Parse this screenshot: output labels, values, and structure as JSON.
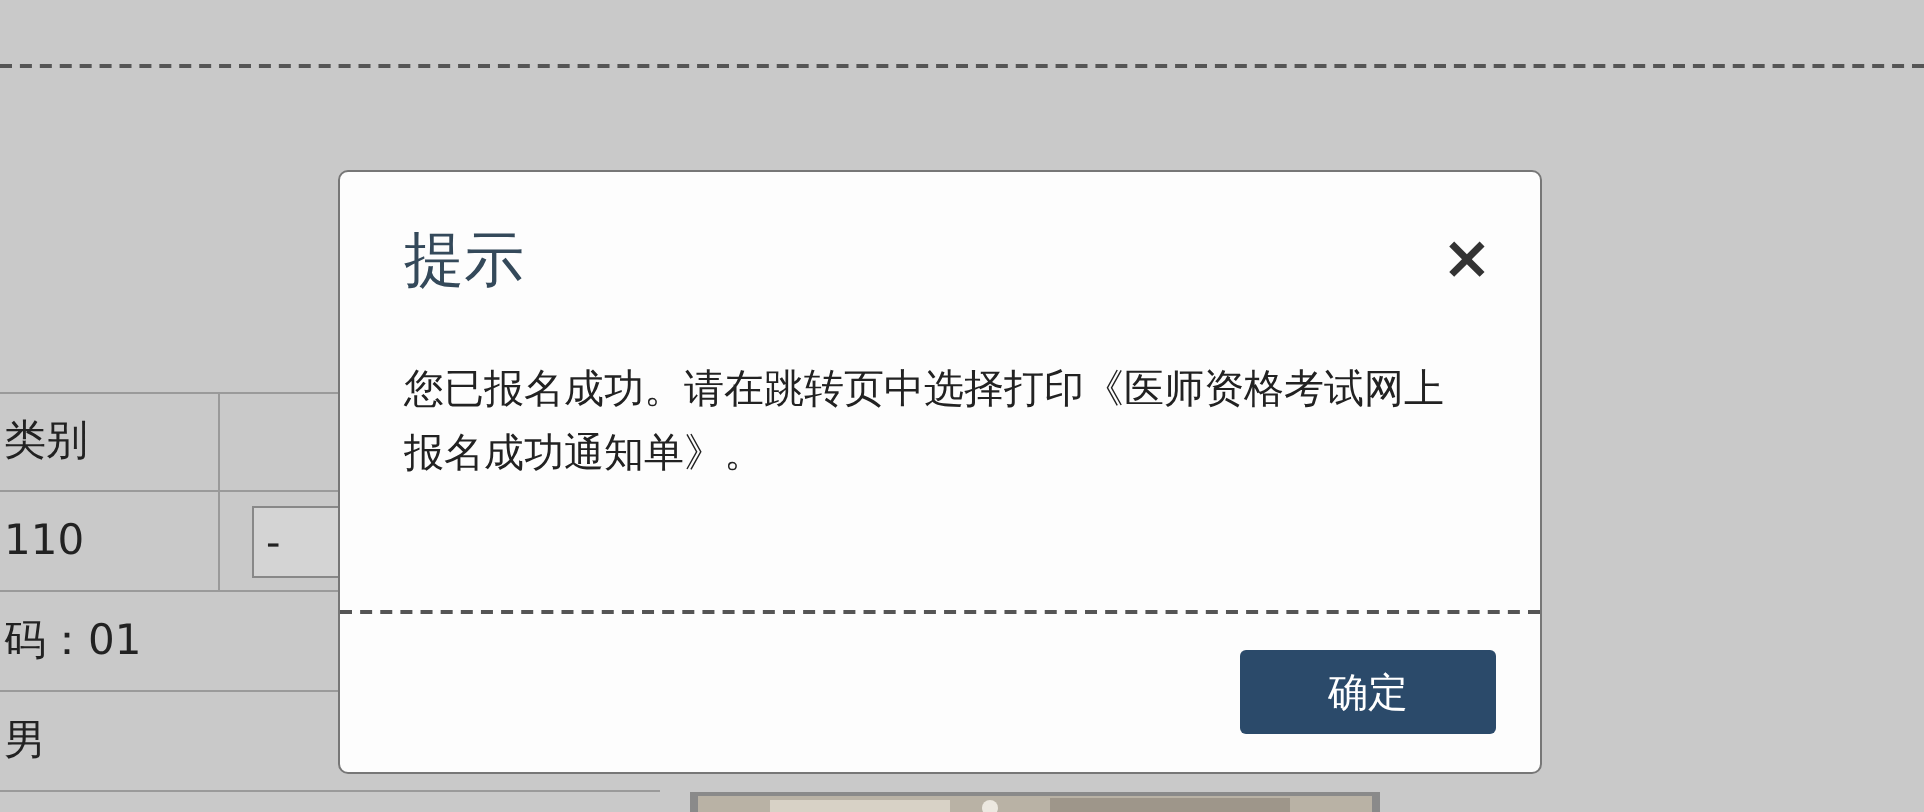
{
  "background_form": {
    "rows": [
      {
        "kind": "split",
        "label": "类别"
      },
      {
        "kind": "split",
        "label": "110",
        "field_value": "-"
      },
      {
        "kind": "full",
        "label": "码：01"
      },
      {
        "kind": "full",
        "label": "男"
      }
    ]
  },
  "dialog": {
    "title": "提示",
    "close": "×",
    "message": "您已报名成功。请在跳转页中选择打印《医师资格考试网上报名成功通知单》。",
    "buttons": [
      "确定"
    ]
  }
}
